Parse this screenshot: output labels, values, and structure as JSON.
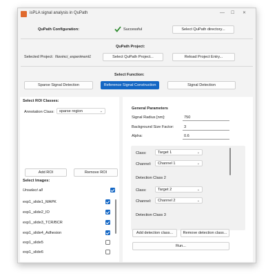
{
  "window": {
    "title": "isPLA signal analysis in QuPath",
    "controls": [
      "—",
      "☐",
      "✕"
    ]
  },
  "config": {
    "label": "QuPath Configuration:",
    "status": "Successful",
    "select_button": "Select QuPath directory..."
  },
  "project": {
    "section_title": "QuPath Project:",
    "selected_label": "Selected Project:",
    "selected_value": "Novinci_experiment1",
    "select_button": "Select QuPath Project...",
    "reload_button": "Reload Project Entry..."
  },
  "function": {
    "section_title": "Select Function:",
    "buttons": [
      "Sparse Signal Detection",
      "Reference Signal Construction",
      "Signal Detection"
    ],
    "active_index": 1
  },
  "roi": {
    "title": "Select ROI Classes:",
    "annotation_label": "Annotation Class:",
    "annotation_value": "sparse region",
    "add_button": "Add ROI",
    "remove_button": "Remove ROI"
  },
  "images": {
    "title": "Select Images:",
    "unselect_all": "Unselect all",
    "items": [
      {
        "name": "exp1_slide1_MAPK",
        "checked": true
      },
      {
        "name": "exp1_slide2_IO",
        "checked": true
      },
      {
        "name": "exp1_slide3_TCR/BCR",
        "checked": true
      },
      {
        "name": "exp1_slide4_Adhesion",
        "checked": true
      },
      {
        "name": "exp1_slide5",
        "checked": false
      },
      {
        "name": "exp1_slide6",
        "checked": false
      }
    ]
  },
  "params": {
    "title": "General Parameters",
    "signal_radius_label": "Signal Radius [nm]:",
    "signal_radius_value": "750",
    "bg_size_label": "Background Size Factor:",
    "bg_size_value": "3",
    "alpha_label": "Alpha:",
    "alpha_value": "0.6"
  },
  "detection": {
    "class_label": "Class:",
    "channel_label": "Channel:",
    "block1": {
      "class": "Target 1",
      "channel": "Channel 1"
    },
    "heading2": "Detection Class 2",
    "block2": {
      "class": "Target 2",
      "channel": "Channel 2"
    },
    "heading3": "Detection Class 3",
    "add_button": "Add detection class...",
    "remove_button": "Remove detection class...",
    "run_button": "Run..."
  },
  "colors": {
    "accent": "#1366c4",
    "success": "#2e8b2e"
  }
}
